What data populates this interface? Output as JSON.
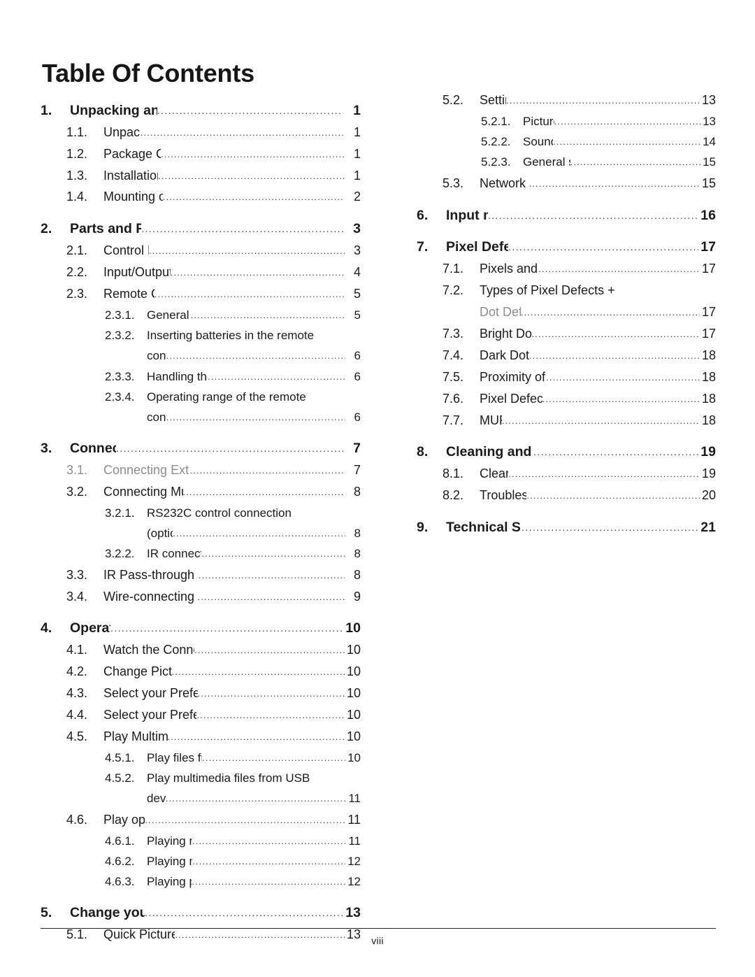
{
  "document": {
    "title": "Table Of Contents",
    "footer_page_number": "viii",
    "leader_dots": "...................................................................................................."
  },
  "toc": {
    "left_column": [
      {
        "level": 1,
        "number": "1.",
        "label": "Unpacking and Installation",
        "page": "1"
      },
      {
        "level": 2,
        "number": "1.1.",
        "label": "Unpacking",
        "page": "1"
      },
      {
        "level": 2,
        "number": "1.2.",
        "label": "Package Contents",
        "page": "1"
      },
      {
        "level": 2,
        "number": "1.3.",
        "label": "Installation Notes",
        "page": "1"
      },
      {
        "level": 2,
        "number": "1.4.",
        "label": "Mounting on a Wall",
        "page": "2"
      },
      {
        "level": 1,
        "number": "2.",
        "label": "Parts and Functions",
        "page": "3"
      },
      {
        "level": 2,
        "number": "2.1.",
        "label": "Control Panel",
        "page": "3"
      },
      {
        "level": 2,
        "number": "2.2.",
        "label": "Input/Output Terminals",
        "page": "4"
      },
      {
        "level": 2,
        "number": "2.3.",
        "label": "Remote Control",
        "page": "5"
      },
      {
        "level": 3,
        "number": "2.3.1.",
        "label": "General functions",
        "page": "5"
      },
      {
        "level": 3,
        "number": "2.3.2.",
        "label": "Inserting batteries in the remote",
        "page": "",
        "wrap": "control",
        "wrap_page": "6"
      },
      {
        "level": 3,
        "number": "2.3.3.",
        "label": "Handling the remote control",
        "page": "6"
      },
      {
        "level": 3,
        "number": "2.3.4.",
        "label": "Operating range of the remote",
        "page": "",
        "wrap": "control",
        "wrap_page": "6"
      },
      {
        "level": 1,
        "number": "3.",
        "label": "Connection",
        "page": "7"
      },
      {
        "level": 2,
        "number": "3.1.",
        "label": "Connecting External Equipments",
        "page": "7",
        "faded": true
      },
      {
        "level": 2,
        "number": "3.2.",
        "label": "Connecting Multiple Displays",
        "page": "8"
      },
      {
        "level": 3,
        "number": "3.2.1.",
        "label": "RS232C control connection",
        "page": "",
        "wrap": "(optional)",
        "wrap_page": "8"
      },
      {
        "level": 3,
        "number": "3.2.2.",
        "label": "IR connection (optional)",
        "page": "8"
      },
      {
        "level": 2,
        "number": "3.3.",
        "label": "IR Pass-through Connection (optional)",
        "page": "8"
      },
      {
        "level": 2,
        "number": "3.4.",
        "label": "Wire-connecting to Network (optional)",
        "page": "9"
      },
      {
        "level": 1,
        "number": "4.",
        "label": "Operation",
        "page": "10"
      },
      {
        "level": 2,
        "number": "4.1.",
        "label": "Watch the Connected Video Source",
        "page": "10"
      },
      {
        "level": 2,
        "number": "4.2.",
        "label": "Change Picture Format",
        "page": "10"
      },
      {
        "level": 2,
        "number": "4.3.",
        "label": "Select your Preferred Picture Settings",
        "page": "10"
      },
      {
        "level": 2,
        "number": "4.4.",
        "label": "Select your Preferred Sound Settings",
        "page": "10"
      },
      {
        "level": 2,
        "number": "4.5.",
        "label": "Play Multimedia Files",
        "page": "10"
      },
      {
        "level": 3,
        "number": "4.5.1.",
        "label": "Play files from computer",
        "page": "10"
      },
      {
        "level": 3,
        "number": "4.5.2.",
        "label": "Play multimedia files from USB",
        "page": "",
        "wrap": "device",
        "wrap_page": "11"
      },
      {
        "level": 2,
        "number": "4.6.",
        "label": "Play options",
        "page": "11"
      },
      {
        "level": 3,
        "number": "4.6.1.",
        "label": "Playing music files",
        "page": "11"
      },
      {
        "level": 3,
        "number": "4.6.2.",
        "label": "Playing movie files",
        "page": "12"
      },
      {
        "level": 3,
        "number": "4.6.3.",
        "label": "Playing photo files",
        "page": "12"
      },
      {
        "level": 1,
        "number": "5.",
        "label": "Change your settings",
        "page": "13"
      },
      {
        "level": 2,
        "number": "5.1.",
        "label": "Quick Picture and Sound",
        "page": "13"
      }
    ],
    "right_column": [
      {
        "level": 2,
        "number": "5.2.",
        "label": "Settings",
        "page": "13"
      },
      {
        "level": 3,
        "number": "5.2.1.",
        "label": "Picture menu",
        "page": "13"
      },
      {
        "level": 3,
        "number": "5.2.2.",
        "label": "Sound menu",
        "page": "14"
      },
      {
        "level": 3,
        "number": "5.2.3.",
        "label": "General settings menu",
        "page": "15"
      },
      {
        "level": 2,
        "number": "5.3.",
        "label": "Network Settings",
        "page": "15"
      },
      {
        "level": 1,
        "number": "6.",
        "label": "Input mode",
        "page": "16"
      },
      {
        "level": 1,
        "number": "7.",
        "label": "Pixel Defect Policy",
        "page": "17"
      },
      {
        "level": 2,
        "number": "7.1.",
        "label": "Pixels and Sub-pixels",
        "page": "17"
      },
      {
        "level": 2,
        "number": "7.2.",
        "label": "Types of Pixel Defects +",
        "page": "",
        "wrap": "Dot Definition",
        "wrap_page": "17",
        "wrap_faded": true
      },
      {
        "level": 2,
        "number": "7.3.",
        "label": "Bright Dot Defects",
        "page": "17"
      },
      {
        "level": 2,
        "number": "7.4.",
        "label": "Dark Dot Defects",
        "page": "18"
      },
      {
        "level": 2,
        "number": "7.5.",
        "label": "Proximity of Pixel Defects",
        "page": "18"
      },
      {
        "level": 2,
        "number": "7.6.",
        "label": "Pixel Defect Tolerances",
        "page": "18"
      },
      {
        "level": 2,
        "number": "7.7.",
        "label": "MURA",
        "page": "18"
      },
      {
        "level": 1,
        "number": "8.",
        "label": "Cleaning and Troubleshooting",
        "page": "19"
      },
      {
        "level": 2,
        "number": "8.1.",
        "label": "Cleaning",
        "page": "19"
      },
      {
        "level": 2,
        "number": "8.2.",
        "label": "Troubleshooting",
        "page": "20"
      },
      {
        "level": 1,
        "number": "9.",
        "label": "Technical Specifications",
        "page": "21"
      }
    ]
  }
}
